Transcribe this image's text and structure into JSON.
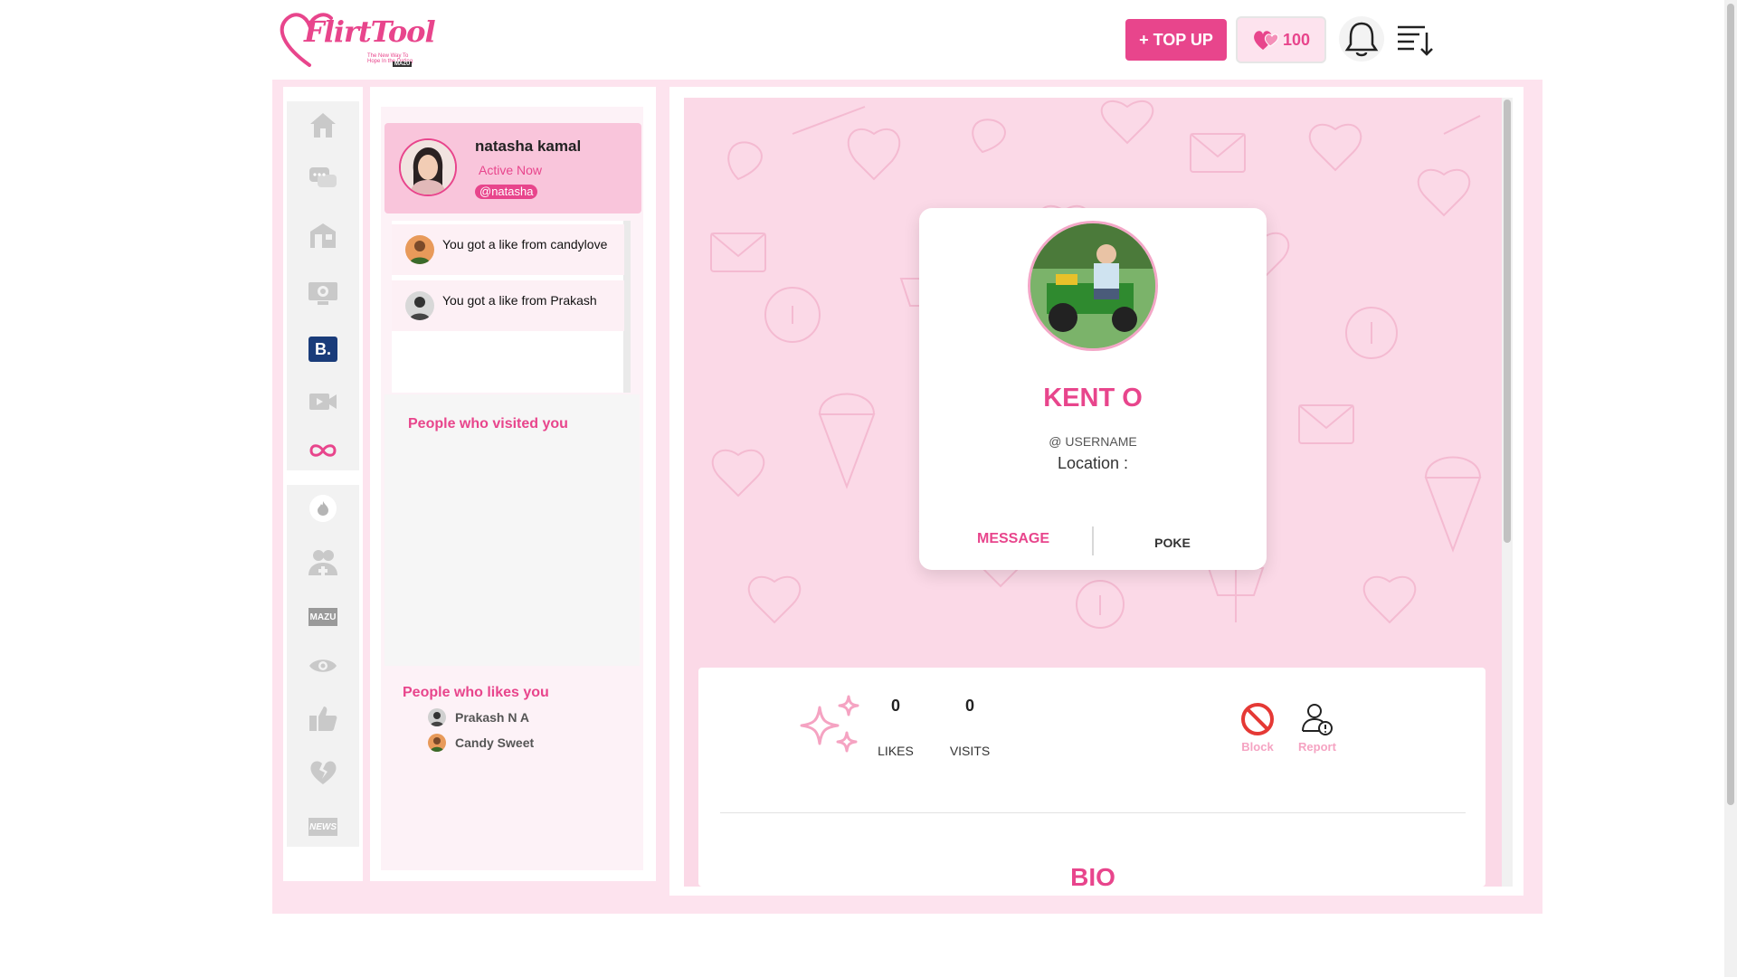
{
  "app": {
    "logo_text": "FlirtTool",
    "logo_tagline": "The New Way To Hope In the Dating",
    "logo_brand": "MAZU"
  },
  "header": {
    "topup_label": "+ TOP UP",
    "coin_count": "100",
    "bell_icon": "bell-icon",
    "menu_icon": "sort-menu-icon"
  },
  "sidebar": {
    "group1": [
      "home-icon",
      "chat-icon",
      "shop-icon",
      "webcam-icon",
      "b-app-icon",
      "video-icon",
      "infinity-icon"
    ],
    "group2": [
      "fire-icon",
      "add-friend-icon",
      "mazu-icon",
      "eye-icon",
      "thumbs-up-icon",
      "broken-heart-icon",
      "news-icon"
    ],
    "mazu_label": "MAZU",
    "b_label": "B.",
    "news_label": "NEWS"
  },
  "profile": {
    "name": "natasha kamal",
    "status": "Active Now",
    "handle": "@natasha"
  },
  "notifications": [
    {
      "text": "You got a like from candylove"
    },
    {
      "text": "You got a like from Prakash"
    }
  ],
  "visited": {
    "title": "People who visited you"
  },
  "likes_you": {
    "title": "People who likes you",
    "people": [
      {
        "name": "Prakash N A"
      },
      {
        "name": "Candy Sweet"
      }
    ]
  },
  "user_card": {
    "name": "KENT O",
    "username": "@ USERNAME",
    "location": "Location :",
    "message_label": "MESSAGE",
    "poke_label": "POKE"
  },
  "stats": {
    "likes_count": "0",
    "likes_label": "LIKES",
    "visits_count": "0",
    "visits_label": "VISITS",
    "block_label": "Block",
    "report_label": "Report"
  },
  "bio": {
    "title": "BIO"
  },
  "colors": {
    "accent": "#e8458c",
    "frame": "#fde3ee",
    "pattern": "#fbd9e7"
  }
}
